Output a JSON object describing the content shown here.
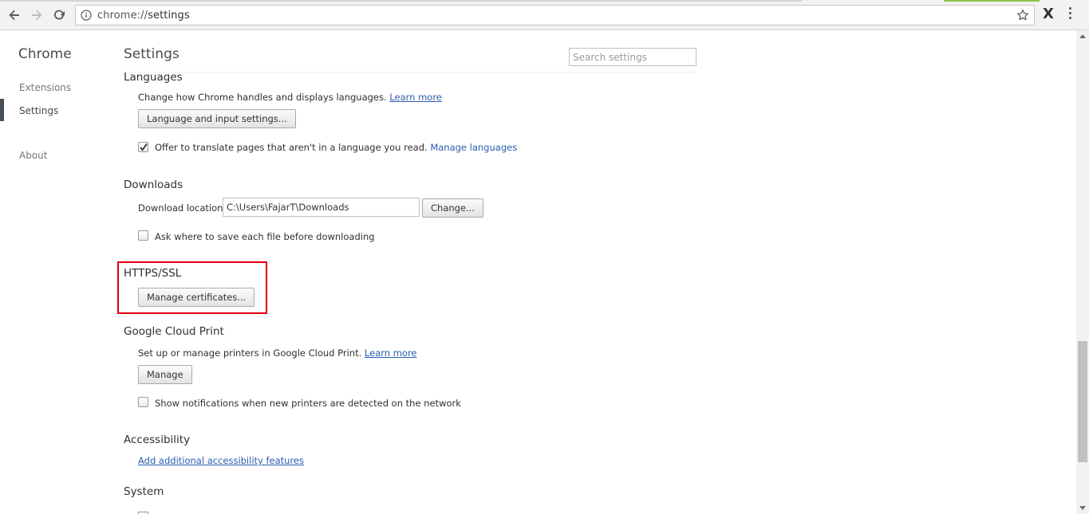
{
  "browser": {
    "url_scheme": "chrome://",
    "url_path": "settings",
    "extension_label": "X"
  },
  "nav": {
    "brand": "Chrome",
    "items": [
      {
        "label": "Extensions"
      },
      {
        "label": "Settings"
      },
      {
        "label": "About"
      }
    ]
  },
  "header": {
    "title": "Settings",
    "search_placeholder": "Search settings"
  },
  "languages": {
    "title": "Languages",
    "description": "Change how Chrome handles and displays languages.",
    "learn_more": "Learn more",
    "button": "Language and input settings...",
    "translate_label": "Offer to translate pages that aren't in a language you read.",
    "translate_checked": true,
    "manage_link": "Manage languages"
  },
  "downloads": {
    "title": "Downloads",
    "location_label": "Download location:",
    "location_value": "C:\\Users\\FajarT\\Downloads",
    "change_button": "Change...",
    "ask_label": "Ask where to save each file before downloading",
    "ask_checked": false
  },
  "https": {
    "title": "HTTPS/SSL",
    "button": "Manage certificates..."
  },
  "cloud_print": {
    "title": "Google Cloud Print",
    "description": "Set up or manage printers in Google Cloud Print.",
    "learn_more": "Learn more",
    "button": "Manage",
    "notify_label": "Show notifications when new printers are detected on the network",
    "notify_checked": false
  },
  "accessibility": {
    "title": "Accessibility",
    "link": "Add additional accessibility features"
  },
  "system": {
    "title": "System"
  },
  "colors": {
    "link": "#2a5db0",
    "highlight": "#e3000f"
  }
}
